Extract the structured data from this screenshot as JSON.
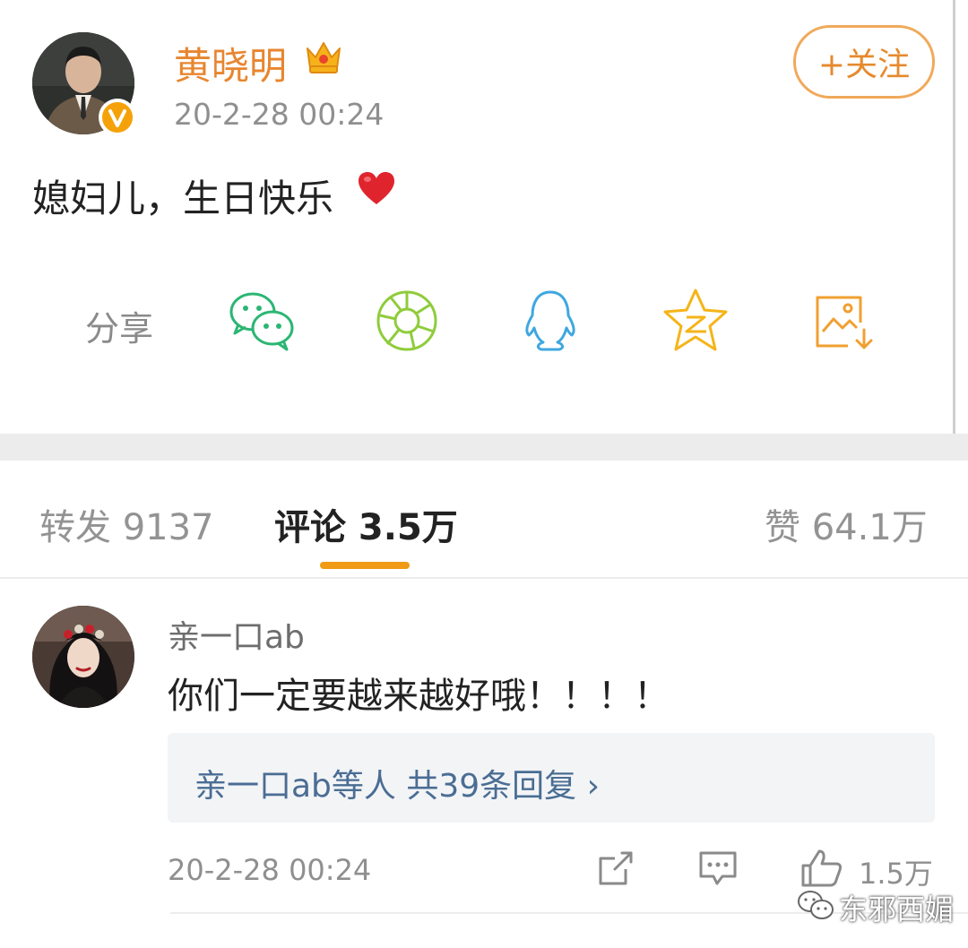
{
  "post": {
    "author_name": "黄晓明",
    "time": "20-2-28 00:24",
    "follow_label": "+关注",
    "text": "媳妇儿，生日快乐"
  },
  "share": {
    "label": "分享",
    "icons": [
      "wechat-icon",
      "moments-icon",
      "qq-icon",
      "qzone-icon",
      "save-image-icon"
    ]
  },
  "tabs": {
    "repost": "转发 9137",
    "comments": "评论 3.5万",
    "likes": "赞 64.1万"
  },
  "comment": {
    "user_name": "亲一口ab",
    "text": "你们一定要越来越好哦！！！！",
    "replies_label": "亲一口ab等人 共39条回复 ›",
    "time": "20-2-28 00:24",
    "like_count": "1.5万"
  },
  "watermark": {
    "text": "东邪西媚"
  },
  "colors": {
    "accent_orange": "#e8862f",
    "tab_underline": "#f09a16",
    "link_blue": "#4a6d94",
    "verified_badge": "#f5a20a"
  }
}
